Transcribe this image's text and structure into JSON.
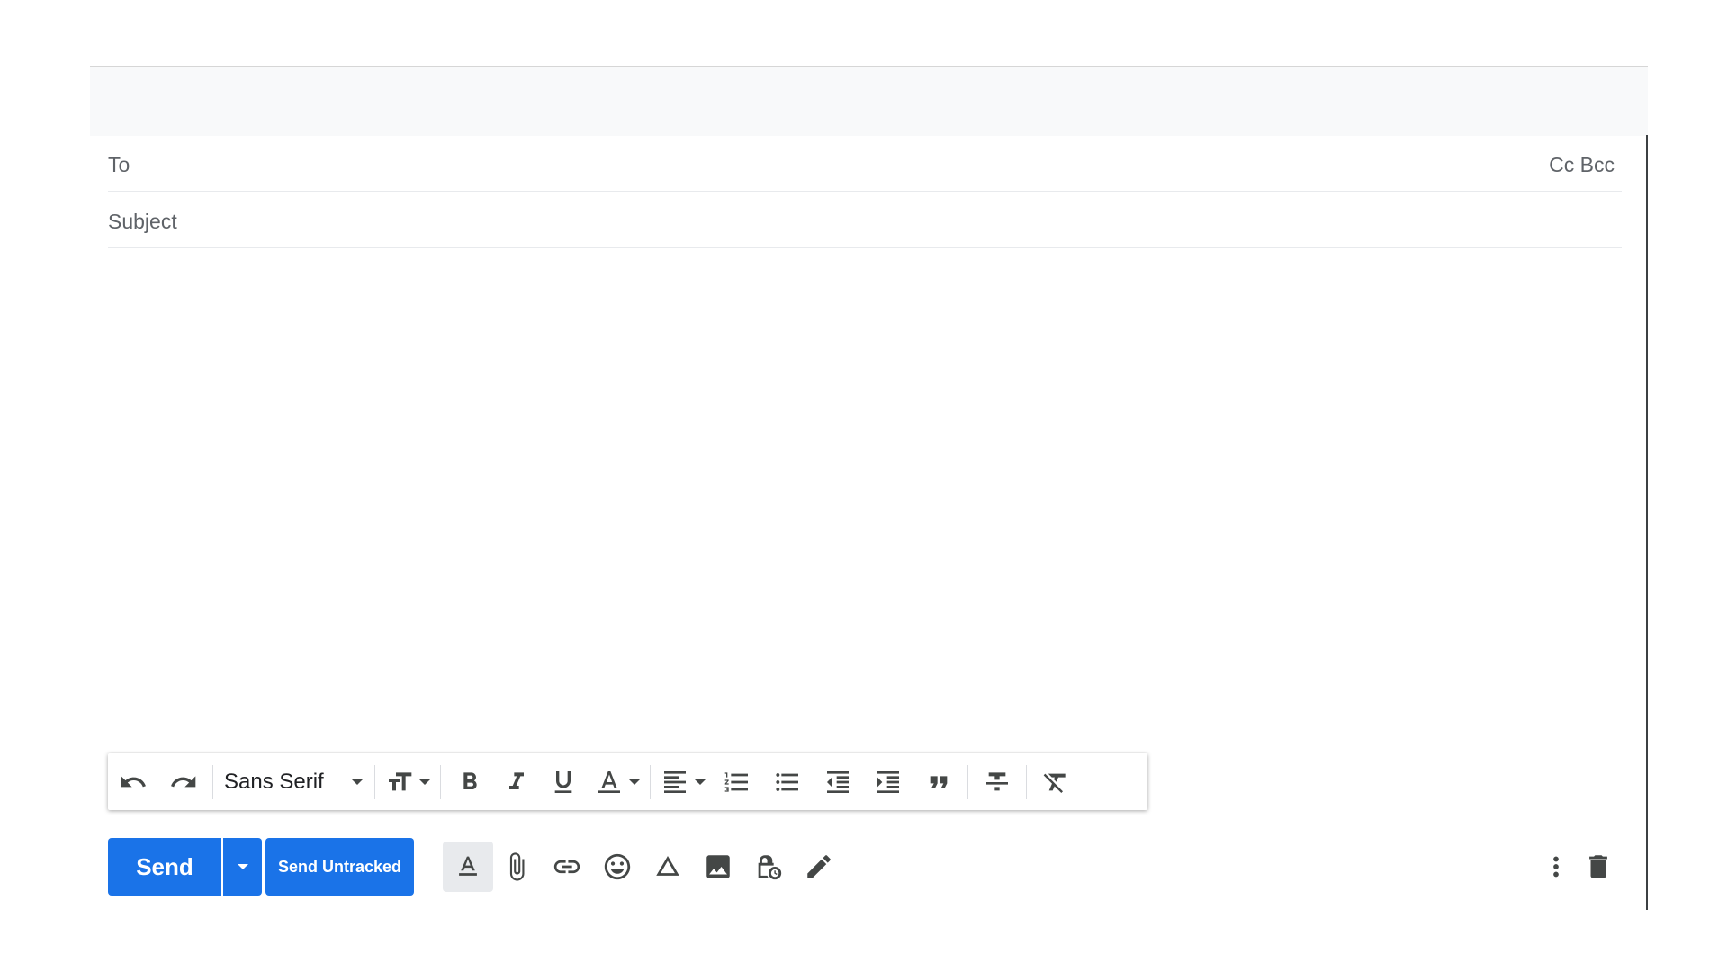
{
  "compose": {
    "to_label": "To",
    "cc_label": "Cc",
    "bcc_label": "Bcc",
    "subject_placeholder": "Subject"
  },
  "toolbar": {
    "font_family": "Sans Serif"
  },
  "actions": {
    "send_label": "Send",
    "send_untracked_label": "Send Untracked"
  },
  "colors": {
    "accent": "#1a73e8",
    "icon": "#444746",
    "header_bg": "#f8f9fa"
  }
}
